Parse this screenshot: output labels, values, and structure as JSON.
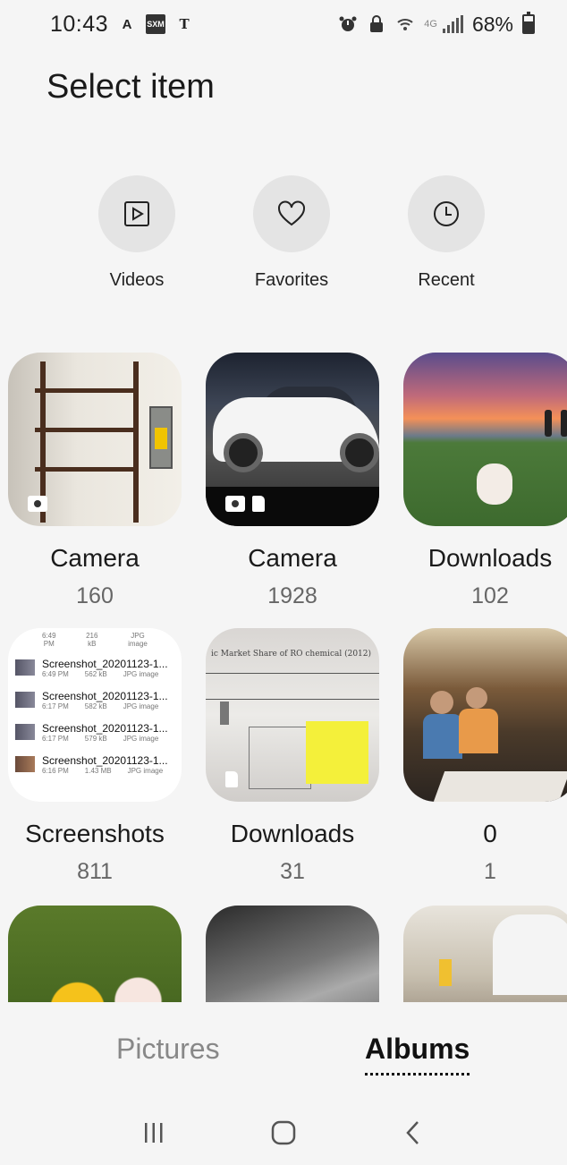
{
  "status_bar": {
    "time": "10:43",
    "left_icons": [
      "a-icon",
      "sxm-icon",
      "nyt-icon"
    ],
    "right_icons": [
      "alarm-icon",
      "lock-icon",
      "wifi-calling-icon",
      "lte-icon",
      "signal-icon"
    ],
    "network": "4G",
    "battery_percent": "68%",
    "battery_level": 0.68
  },
  "header": {
    "title": "Select item"
  },
  "quick_filters": [
    {
      "label": "Videos",
      "icon": "play-icon"
    },
    {
      "label": "Favorites",
      "icon": "heart-icon"
    },
    {
      "label": "Recent",
      "icon": "clock-icon"
    }
  ],
  "albums": [
    {
      "name": "Camera",
      "count": "160"
    },
    {
      "name": "Camera",
      "count": "1928"
    },
    {
      "name": "Downloads",
      "count": "102"
    },
    {
      "name": "Screenshots",
      "count": "811"
    },
    {
      "name": "Downloads",
      "count": "31"
    },
    {
      "name": "0",
      "count": "1"
    }
  ],
  "screenshot_thumb": {
    "top": {
      "time": "6:49 PM",
      "size": "216 kB",
      "type": "JPG image"
    },
    "rows": [
      {
        "name": "Screenshot_20201123-1...",
        "time": "6:49 PM",
        "size": "562 kB",
        "type": "JPG image"
      },
      {
        "name": "Screenshot_20201123-1...",
        "time": "6:17 PM",
        "size": "582 kB",
        "type": "JPG image"
      },
      {
        "name": "Screenshot_20201123-1...",
        "time": "6:17 PM",
        "size": "579 kB",
        "type": "JPG image"
      },
      {
        "name": "Screenshot_20201123-1...",
        "time": "6:16 PM",
        "size": "1.43 MB",
        "type": "JPG image"
      }
    ]
  },
  "doc_thumb": {
    "caption": "ic Market Share of RO chemical (2012)"
  },
  "tabs": {
    "pictures": "Pictures",
    "albums": "Albums",
    "active": "Albums"
  },
  "nav": {
    "recents_icon": "recents-icon",
    "home_icon": "home-icon",
    "back_icon": "back-icon"
  }
}
